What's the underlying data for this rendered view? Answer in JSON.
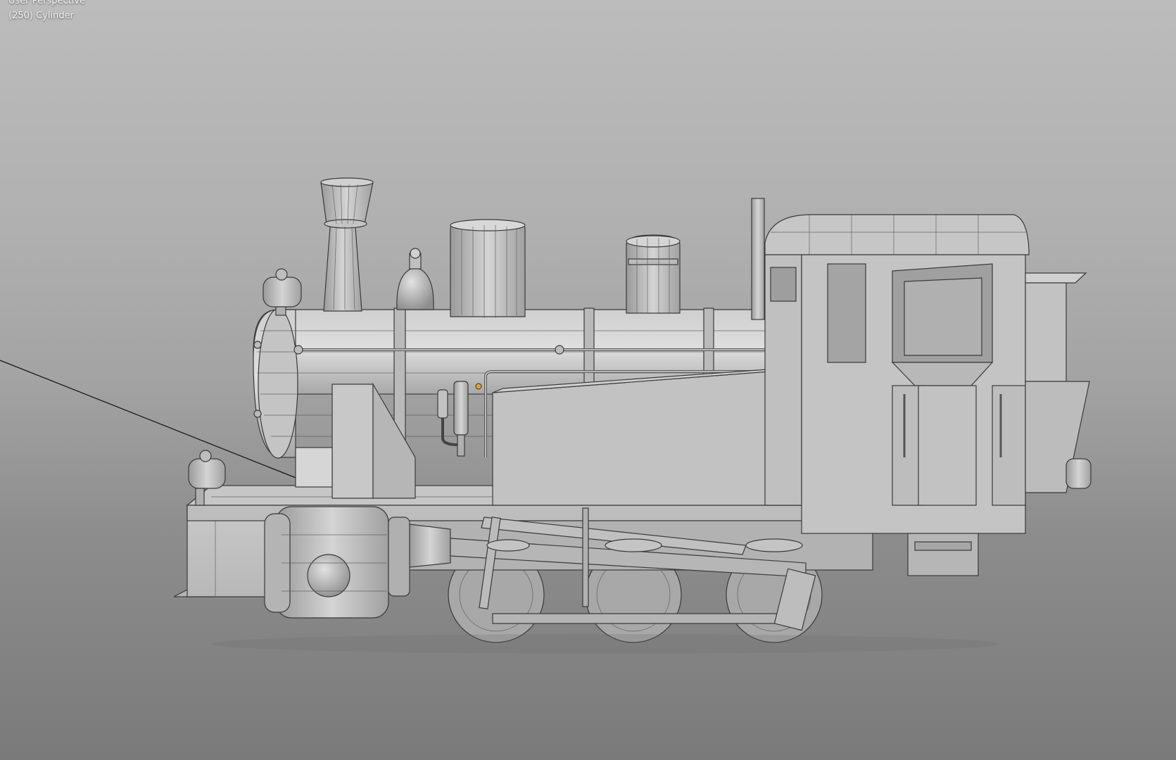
{
  "viewport": {
    "view_mode": "User Perspective",
    "object_info": "(250) Cylinder",
    "active_object": "Cylinder",
    "frame": 250
  },
  "scene": {
    "model": "steam-locomotive",
    "accent_color": "#e0a030",
    "mesh_color": "#c4c4c4",
    "edge_color": "#3a3a3a"
  }
}
